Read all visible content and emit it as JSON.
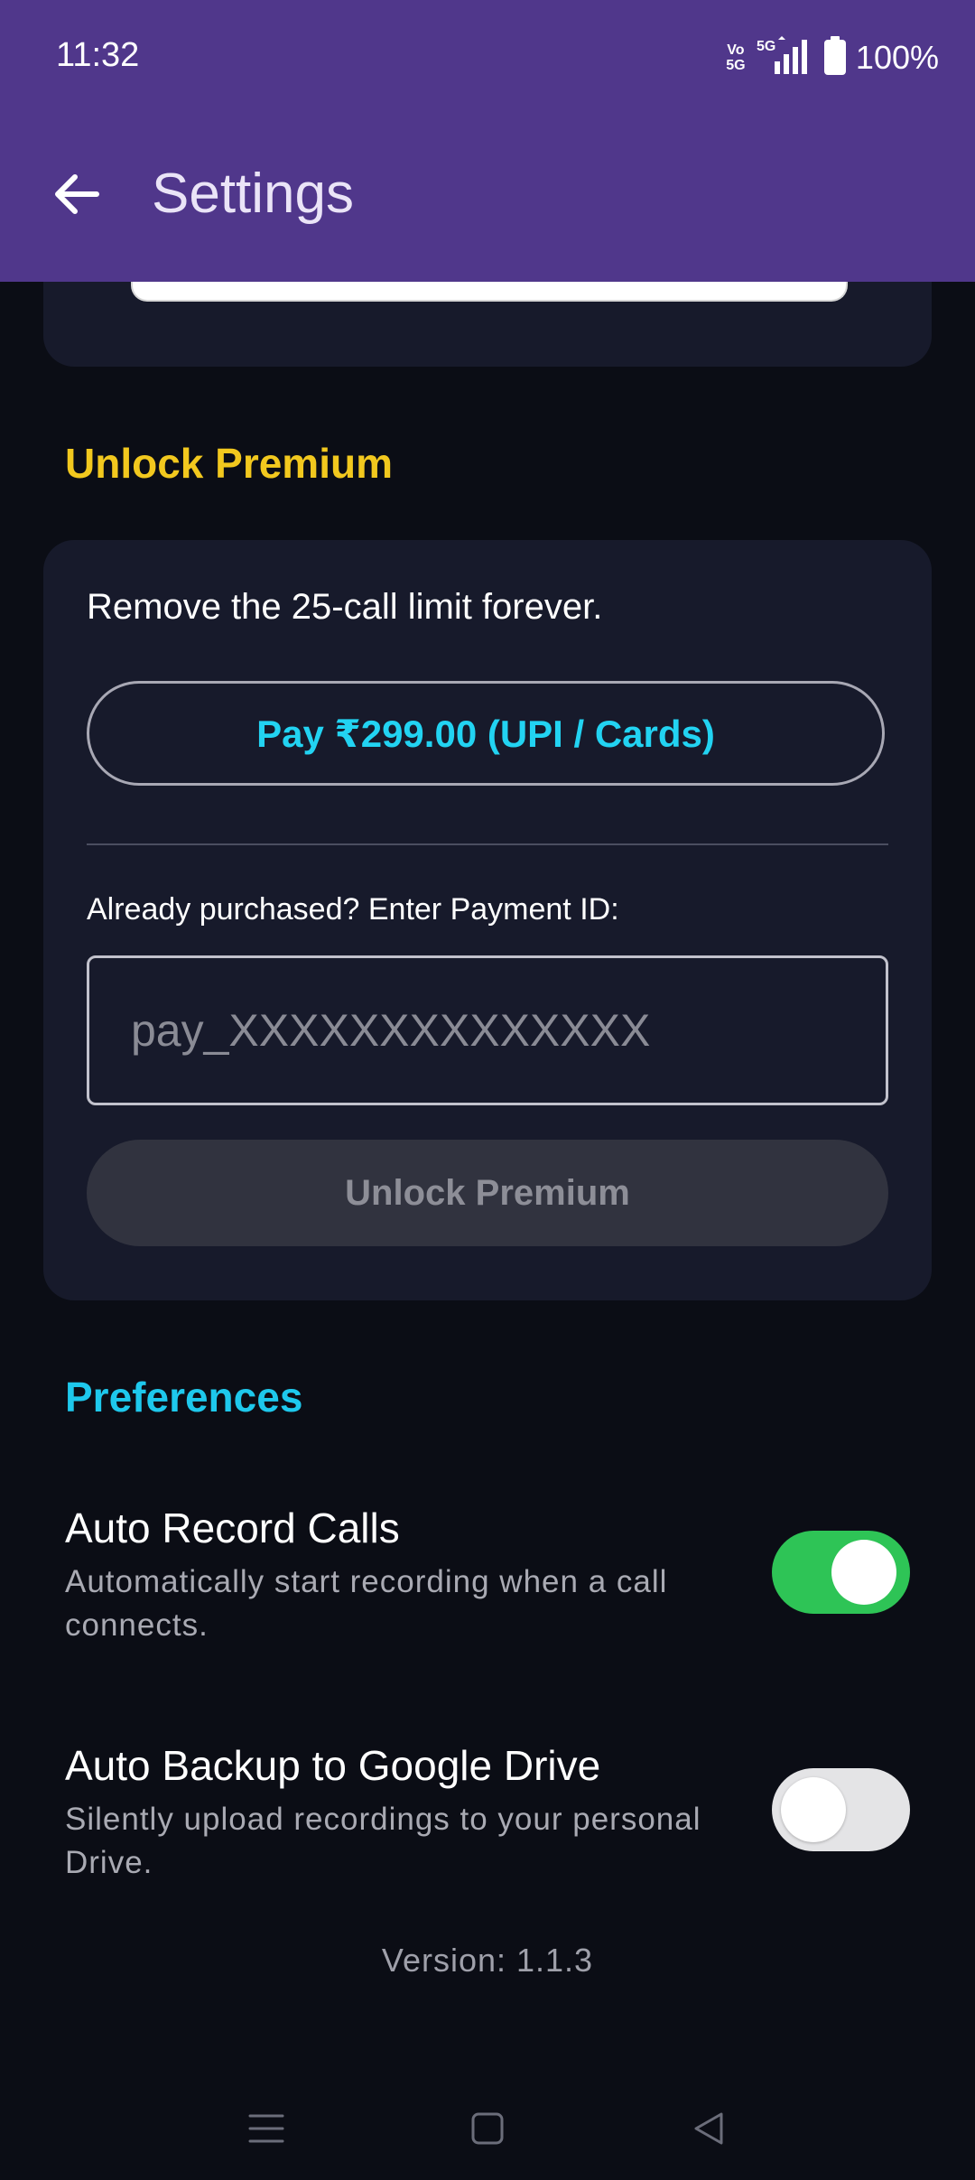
{
  "status_bar": {
    "time": "11:32",
    "volte_label": "Vo\n5G",
    "network": "5G",
    "battery_percent": "100%"
  },
  "header": {
    "title": "Settings",
    "back_icon": "arrow-left-icon",
    "background_color": "#50378b"
  },
  "premium": {
    "section_title": "Unlock Premium",
    "description": "Remove the 25-call limit forever.",
    "pay_button_label": "Pay ₹299.00 (UPI / Cards)",
    "already_purchased_label": "Already purchased? Enter Payment ID:",
    "payment_id_value": "",
    "payment_id_placeholder": "pay_XXXXXXXXXXXXXX",
    "unlock_button_label": "Unlock Premium",
    "unlock_button_enabled": false,
    "title_color": "#f2c81e",
    "accent_color": "#22d3f2"
  },
  "preferences": {
    "section_title": "Preferences",
    "title_color": "#1ec8ec",
    "items": [
      {
        "title": "Auto Record Calls",
        "description": "Automatically start recording when a call connects.",
        "enabled": true
      },
      {
        "title": "Auto Backup to Google Drive",
        "description": "Silently upload recordings to your personal Drive.",
        "enabled": false
      }
    ]
  },
  "footer": {
    "version": "Version: 1.1.3"
  },
  "nav_bar": {
    "icons": [
      "menu-icon",
      "home-square-icon",
      "back-triangle-icon"
    ]
  }
}
